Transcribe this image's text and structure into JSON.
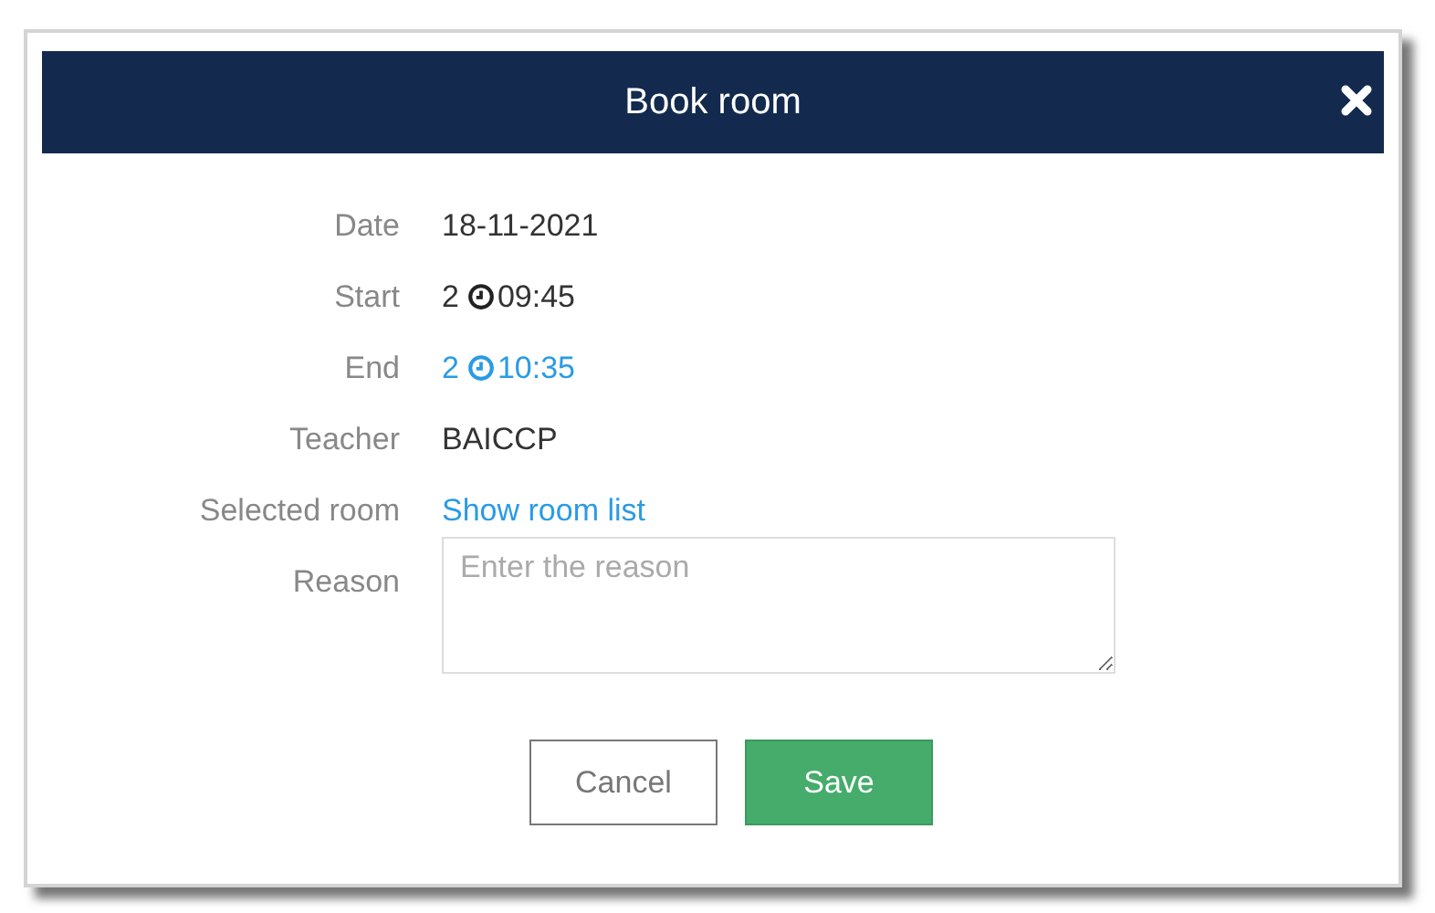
{
  "dialog": {
    "title": "Book room"
  },
  "fields": [
    {
      "kind": "text",
      "label": "Date",
      "value": "18-11-2021"
    },
    {
      "kind": "time",
      "label": "Start",
      "day": "2",
      "time": "09:45",
      "link": false
    },
    {
      "kind": "time",
      "label": "End",
      "day": "2",
      "time": "10:35",
      "link": true
    },
    {
      "kind": "text",
      "label": "Teacher",
      "value": "BAICCP"
    },
    {
      "kind": "link",
      "label": "Selected room",
      "value": "Show room list"
    },
    {
      "kind": "textarea",
      "label": "Reason",
      "placeholder": "Enter the reason"
    }
  ],
  "buttons": [
    {
      "kind": "secondary",
      "label": "Cancel"
    },
    {
      "kind": "primary",
      "label": "Save"
    }
  ]
}
